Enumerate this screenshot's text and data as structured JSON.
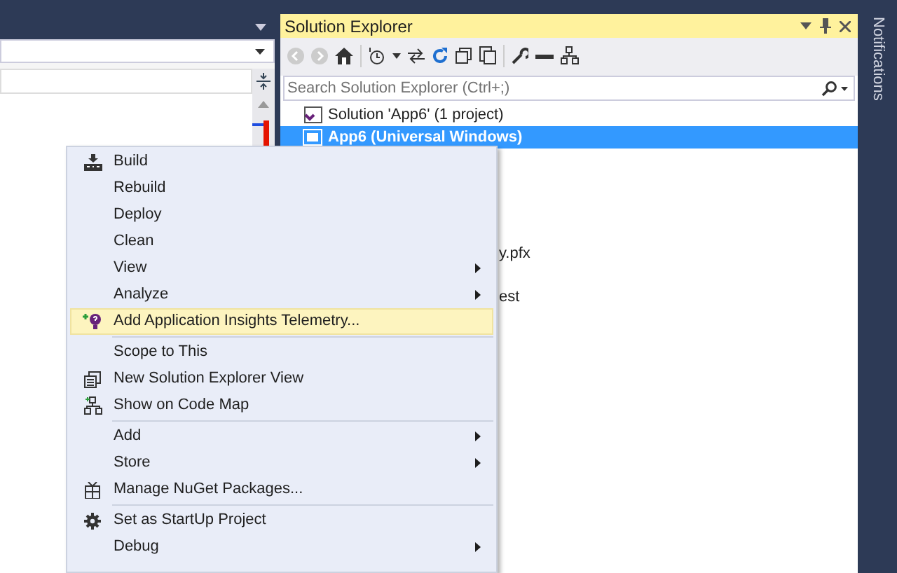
{
  "solution_explorer": {
    "title": "Solution Explorer",
    "search": {
      "placeholder": "Search Solution Explorer (Ctrl+;)"
    },
    "tree": [
      {
        "label": "Solution 'App6' (1 project)",
        "kind": "solution",
        "selected": false
      },
      {
        "label": "App6 (Universal Windows)",
        "kind": "project",
        "selected": true
      },
      {
        "label": "y.pfx",
        "kind": "covered",
        "selected": false
      },
      {
        "label": "est",
        "kind": "covered",
        "selected": false
      }
    ]
  },
  "notifications": {
    "label": "Notifications"
  },
  "context_menu": {
    "items": [
      {
        "label": "Build",
        "kind": "build",
        "submenu": false,
        "highlighted": false
      },
      {
        "label": "Rebuild",
        "kind": "plain",
        "submenu": false,
        "highlighted": false
      },
      {
        "label": "Deploy",
        "kind": "plain",
        "submenu": false,
        "highlighted": false
      },
      {
        "label": "Clean",
        "kind": "plain",
        "submenu": false,
        "highlighted": false
      },
      {
        "label": "View",
        "kind": "plain",
        "submenu": true,
        "highlighted": false
      },
      {
        "label": "Analyze",
        "kind": "plain",
        "submenu": true,
        "highlighted": false
      },
      {
        "label": "Add Application Insights Telemetry...",
        "kind": "insights",
        "submenu": false,
        "highlighted": true
      },
      {
        "kind": "separator"
      },
      {
        "label": "Scope to This",
        "kind": "plain",
        "submenu": false,
        "highlighted": false
      },
      {
        "label": "New Solution Explorer View",
        "kind": "windows",
        "submenu": false,
        "highlighted": false
      },
      {
        "label": "Show on Code Map",
        "kind": "codemap",
        "submenu": false,
        "highlighted": false
      },
      {
        "kind": "separator"
      },
      {
        "label": "Add",
        "kind": "plain",
        "submenu": true,
        "highlighted": false
      },
      {
        "label": "Store",
        "kind": "plain",
        "submenu": true,
        "highlighted": false
      },
      {
        "label": "Manage NuGet Packages...",
        "kind": "package",
        "submenu": false,
        "highlighted": false
      },
      {
        "kind": "separator"
      },
      {
        "label": "Set as StartUp Project",
        "kind": "gear",
        "submenu": false,
        "highlighted": false
      },
      {
        "label": "Debug",
        "kind": "plain",
        "submenu": true,
        "highlighted": false
      }
    ]
  }
}
